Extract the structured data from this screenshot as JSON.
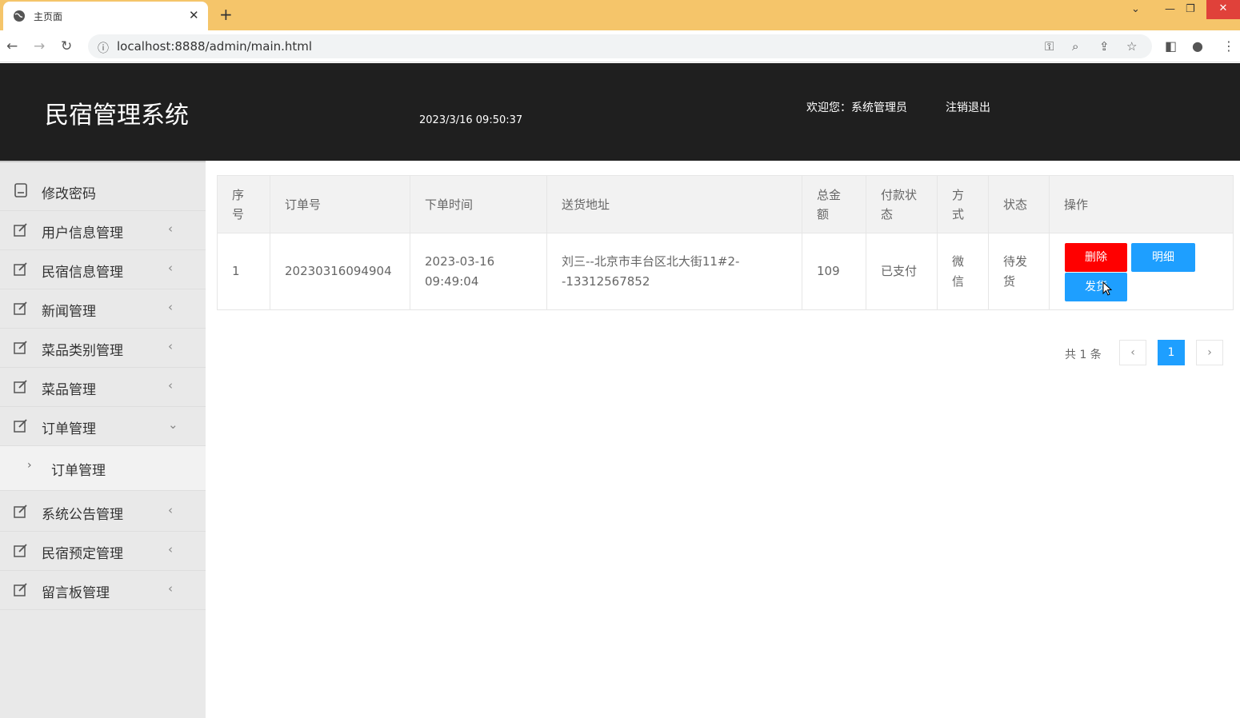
{
  "browser": {
    "tab_title": "主页面",
    "url": "localhost:8888/admin/main.html",
    "tabbar_color": "#f5c56a"
  },
  "header": {
    "title": "民宿管理系统",
    "datetime": "2023/3/16 09:50:37",
    "welcome": "欢迎您：系统管理员",
    "logout": "注销退出"
  },
  "sidebar": {
    "items": [
      {
        "label": "修改密码",
        "icon": "document-icon",
        "arrow": ""
      },
      {
        "label": "用户信息管理",
        "icon": "edit-icon",
        "arrow": "‹"
      },
      {
        "label": "民宿信息管理",
        "icon": "edit-icon",
        "arrow": "‹"
      },
      {
        "label": "新闻管理",
        "icon": "edit-icon",
        "arrow": "‹"
      },
      {
        "label": "菜品类别管理",
        "icon": "edit-icon",
        "arrow": "‹"
      },
      {
        "label": "菜品管理",
        "icon": "edit-icon",
        "arrow": "‹"
      },
      {
        "label": "订单管理",
        "icon": "edit-icon",
        "arrow": "⌄"
      },
      {
        "label": "系统公告管理",
        "icon": "edit-icon",
        "arrow": "‹"
      },
      {
        "label": "民宿预定管理",
        "icon": "edit-icon",
        "arrow": "‹"
      },
      {
        "label": "留言板管理",
        "icon": "edit-icon",
        "arrow": "‹"
      }
    ],
    "submenu": {
      "label": "订单管理",
      "arrow": "›"
    }
  },
  "table": {
    "headers": [
      "序号",
      "订单号",
      "下单时间",
      "送货地址",
      "总金额",
      "付款状态",
      "方式",
      "状态",
      "操作"
    ],
    "rows": [
      {
        "index": "1",
        "order_no": "20230316094904",
        "time": "2023-03-16 09:49:04",
        "address": "刘三--北京市丰台区北大街11#2--13312567852",
        "amount": "109",
        "pay_status": "已支付",
        "method": "微信",
        "status": "待发货"
      }
    ],
    "actions": {
      "delete": "删除",
      "detail": "明细",
      "ship": "发货"
    }
  },
  "pager": {
    "total": "共 1 条",
    "prev": "‹",
    "current": "1",
    "next": "›"
  },
  "colors": {
    "header_bg": "#1f1f1f",
    "danger": "#ff0000",
    "primary": "#1e9fff"
  }
}
